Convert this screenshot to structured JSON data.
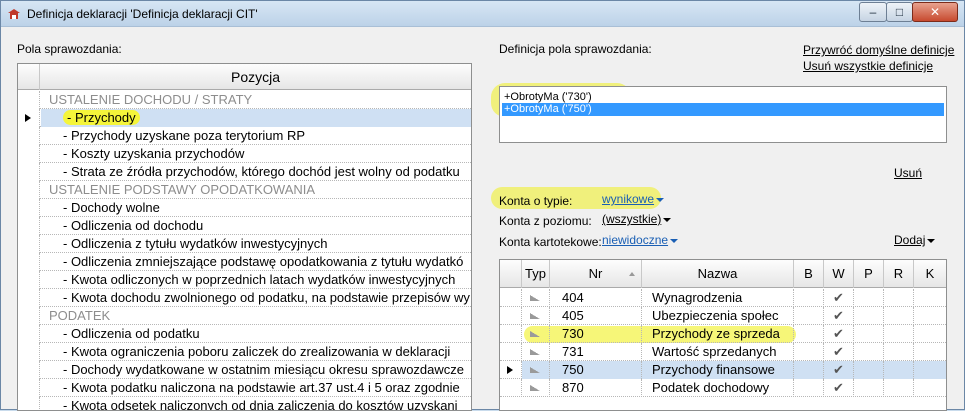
{
  "window": {
    "title": "Definicja deklaracji 'Definicja deklaracji CIT'",
    "icons": {
      "app": "app-cap-icon",
      "minimize": "minimize-icon",
      "maximize": "maximize-icon",
      "close": "close-icon"
    },
    "controls": {
      "minimize": "–",
      "maximize": "□",
      "close": "✕"
    }
  },
  "left_panel": {
    "label": "Pola sprawozdania:",
    "column_header": "Pozycja",
    "rows": [
      {
        "text": "USTALENIE DOCHODU / STRATY",
        "kind": "group"
      },
      {
        "text": "- Przychody",
        "kind": "child",
        "selected": true
      },
      {
        "text": "- Przychody uzyskane poza terytorium RP",
        "kind": "child"
      },
      {
        "text": "- Koszty uzyskania przychodów",
        "kind": "child"
      },
      {
        "text": "- Strata ze źródła przychodów, którego dochód jest wolny od podatku",
        "kind": "child"
      },
      {
        "text": "USTALENIE PODSTAWY OPODATKOWANIA",
        "kind": "group"
      },
      {
        "text": "- Dochody wolne",
        "kind": "child"
      },
      {
        "text": "- Odliczenia od dochodu",
        "kind": "child"
      },
      {
        "text": "- Odliczenia z tytułu wydatków inwestycyjnych",
        "kind": "child"
      },
      {
        "text": "- Odliczenia zmniejszające podstawę opodatkowania z tytułu wydatkó",
        "kind": "child"
      },
      {
        "text": "- Kwota odliczonych w poprzednich latach wydatków inwestycyjnych",
        "kind": "child"
      },
      {
        "text": "- Kwota dochodu zwolnionego od podatku, na podstawie przepisów wy",
        "kind": "child"
      },
      {
        "text": "PODATEK",
        "kind": "group"
      },
      {
        "text": "- Odliczenia od podatku",
        "kind": "child"
      },
      {
        "text": "- Kwota ograniczenia poboru zaliczek do zrealizowania w deklaracji",
        "kind": "child"
      },
      {
        "text": "- Dochody wydatkowane w ostatnim miesiącu okresu sprawozdawcze",
        "kind": "child"
      },
      {
        "text": "- Kwota podatku naliczona na podstawie art.37 ust.4 i 5 oraz zgodnie",
        "kind": "child"
      },
      {
        "text": "- Kwota odsetek naliczonych od dnia zaliczenia do kosztów uzyskani",
        "kind": "child"
      }
    ]
  },
  "right_panel": {
    "definition_label": "Definicja pola sprawozdania:",
    "link_restore": "Przywróć domyślne definicje",
    "link_remove_all": "Usuń wszystkie definicje",
    "definitions": [
      {
        "text": "+ObrotyMa ('730')",
        "selected": false
      },
      {
        "text": "+ObrotyMa ('750')",
        "selected": true
      }
    ],
    "remove_link": "Usuń",
    "filters": {
      "account_type_label": "Konta o typie:",
      "account_type_value": "wynikowe",
      "account_level_label": "Konta z poziomu:",
      "account_level_value": "(wszystkie)",
      "card_accounts_label": "Konta kartotekowe:",
      "card_accounts_value": "niewidoczne"
    },
    "add_menu": "Dodaj",
    "accounts_table": {
      "headers": {
        "typ": "Typ",
        "nr": "Nr",
        "nazwa": "Nazwa",
        "b": "B",
        "w": "W",
        "p": "P",
        "r": "R",
        "k": "K"
      },
      "check_glyph": "✔",
      "rows": [
        {
          "nr": "404",
          "nazwa": "Wynagrodzenia",
          "w": true,
          "selected": false,
          "highlight": false
        },
        {
          "nr": "405",
          "nazwa": "Ubezpieczenia społec",
          "w": true,
          "selected": false,
          "highlight": false
        },
        {
          "nr": "730",
          "nazwa": "Przychody ze sprzeda",
          "w": true,
          "selected": false,
          "highlight": true
        },
        {
          "nr": "731",
          "nazwa": "Wartość sprzedanych",
          "w": true,
          "selected": false,
          "highlight": false
        },
        {
          "nr": "750",
          "nazwa": "Przychody finansowe",
          "w": true,
          "selected": true,
          "highlight": true
        },
        {
          "nr": "870",
          "nazwa": "Podatek dochodowy",
          "w": true,
          "selected": false,
          "highlight": false
        }
      ]
    }
  },
  "colors": {
    "highlight_yellow": "#f5f53a",
    "selection_blue": "#3399ff",
    "row_selection": "#cfe0f3",
    "link_blue": "#1a5fb4",
    "group_gray": "#8d8d8d"
  }
}
